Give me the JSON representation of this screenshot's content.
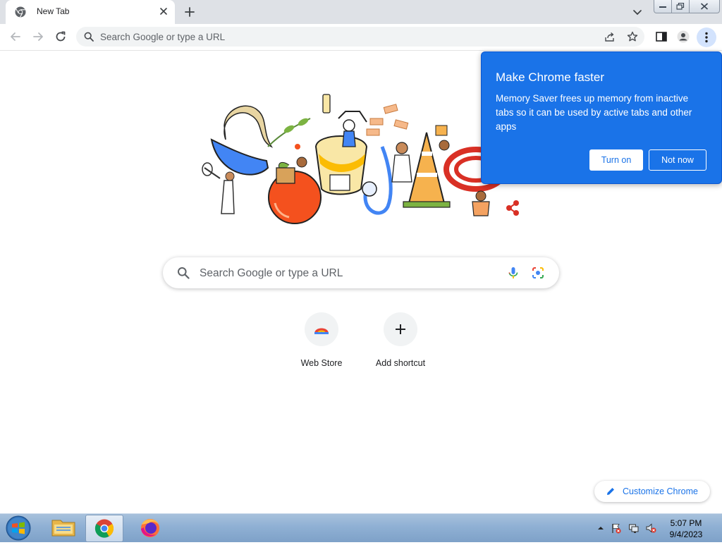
{
  "browser": {
    "tab": {
      "title": "New Tab"
    },
    "omnibox": {
      "placeholder": "Search Google or type a URL"
    }
  },
  "ntp": {
    "search_placeholder": "Search Google or type a URL",
    "shortcuts": [
      {
        "label": "Web Store",
        "icon": "web-store-icon"
      },
      {
        "label": "Add shortcut",
        "icon": "plus-icon"
      }
    ],
    "customize_label": "Customize Chrome"
  },
  "promo": {
    "title": "Make Chrome faster",
    "body": "Memory Saver frees up memory from inactive tabs so it can be used by active tabs and other apps",
    "primary_button": "Turn on",
    "secondary_button": "Not now"
  },
  "taskbar": {
    "time": "5:07 PM",
    "date": "9/4/2023"
  },
  "colors": {
    "accent": "#1a73e8",
    "tabstrip": "#dee1e6",
    "omnibox_bg": "#f1f3f4",
    "menu_highlight": "#d3e3fd"
  }
}
